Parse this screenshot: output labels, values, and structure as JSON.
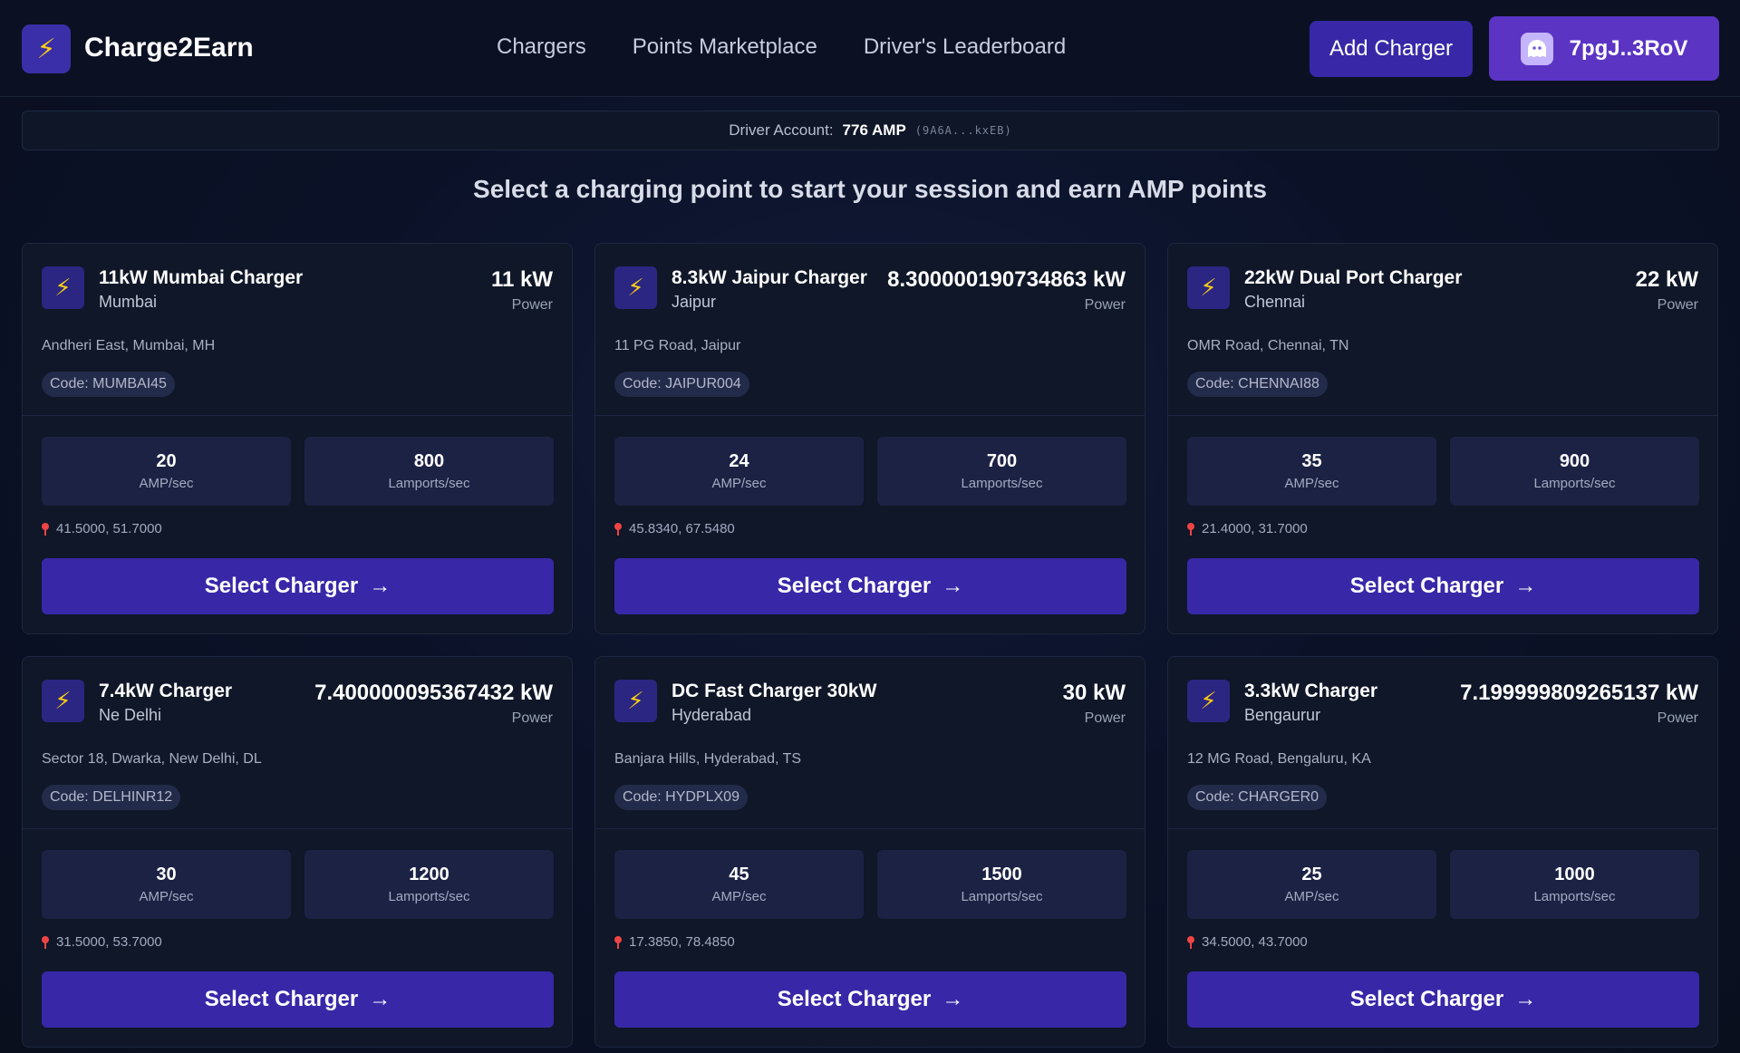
{
  "header": {
    "logo_icon": "lightning-bolt",
    "app_name": "Charge2Earn",
    "nav": [
      "Chargers",
      "Points Marketplace",
      "Driver's Leaderboard"
    ],
    "add_charger_label": "Add Charger",
    "wallet_label": "7pgJ..3RoV",
    "wallet_icon": "ghost-icon"
  },
  "account": {
    "label": "Driver Account:",
    "balance": "776 AMP",
    "address": "(9A6A...kxEB)"
  },
  "subtitle": "Select a charging point to start your session and earn AMP points",
  "labels": {
    "power": "Power",
    "amp_per_sec": "AMP/sec",
    "lamports_per_sec": "Lamports/sec",
    "select": "Select Charger",
    "arrow": "→"
  },
  "chargers": [
    {
      "name": "11kW Mumbai Charger",
      "city": "Mumbai",
      "power": "11 kW",
      "address": "Andheri East, Mumbai, MH",
      "code": "Code: MUMBAI45",
      "amp": "20",
      "lamports": "800",
      "coords": "41.5000, 51.7000"
    },
    {
      "name": "8.3kW Jaipur Charger",
      "city": "Jaipur",
      "power": "8.300000190734863 kW",
      "address": "11 PG Road, Jaipur",
      "code": "Code: JAIPUR004",
      "amp": "24",
      "lamports": "700",
      "coords": "45.8340, 67.5480"
    },
    {
      "name": "22kW Dual Port Charger",
      "city": "Chennai",
      "power": "22 kW",
      "address": "OMR Road, Chennai, TN",
      "code": "Code: CHENNAI88",
      "amp": "35",
      "lamports": "900",
      "coords": "21.4000, 31.7000"
    },
    {
      "name": "7.4kW Charger",
      "city": "Ne Delhi",
      "power": "7.400000095367432 kW",
      "address": "Sector 18, Dwarka, New Delhi, DL",
      "code": "Code: DELHINR12",
      "amp": "30",
      "lamports": "1200",
      "coords": "31.5000, 53.7000"
    },
    {
      "name": "DC Fast Charger 30kW",
      "city": "Hyderabad",
      "power": "30 kW",
      "address": "Banjara Hills, Hyderabad, TS",
      "code": "Code: HYDPLX09",
      "amp": "45",
      "lamports": "1500",
      "coords": "17.3850, 78.4850"
    },
    {
      "name": "3.3kW Charger",
      "city": "Bengaurur",
      "power": "7.199999809265137 kW",
      "address": "12 MG Road, Bengaluru, KA",
      "code": "Code: CHARGER0",
      "amp": "25",
      "lamports": "1000",
      "coords": "34.5000, 43.7000"
    }
  ]
}
